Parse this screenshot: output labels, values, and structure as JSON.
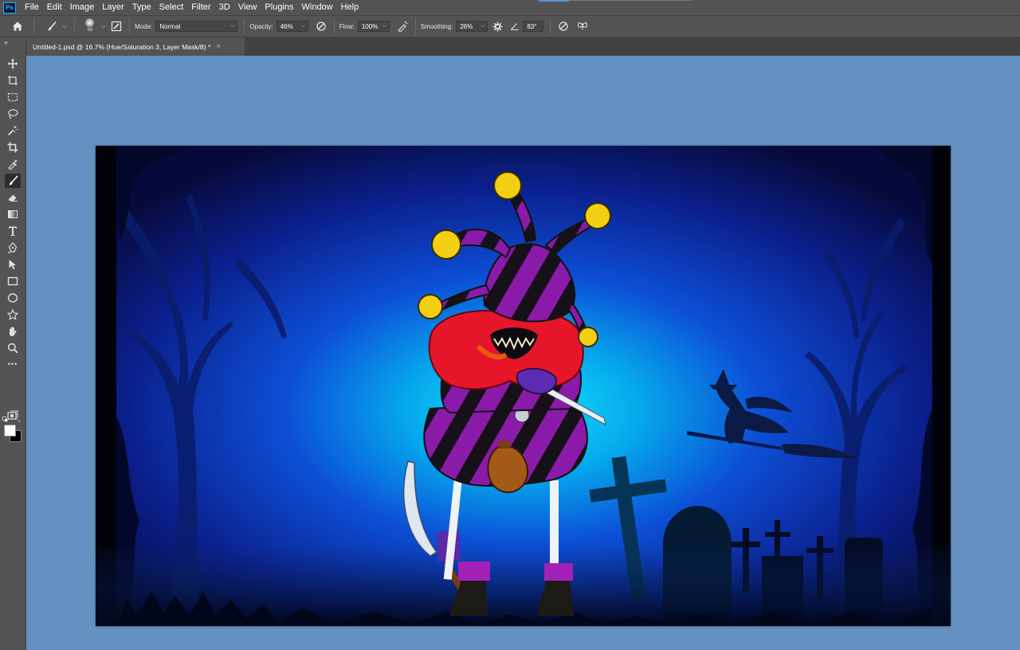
{
  "app": {
    "logo_text": "Ps"
  },
  "menu": [
    "File",
    "Edit",
    "Image",
    "Layer",
    "Type",
    "Select",
    "Filter",
    "3D",
    "View",
    "Plugins",
    "Window",
    "Help"
  ],
  "options": {
    "brush_size": "88",
    "mode_label": "Mode:",
    "mode_value": "Normal",
    "opacity_label": "Opacity:",
    "opacity_value": "46%",
    "flow_label": "Flow:",
    "flow_value": "100%",
    "smoothing_label": "Smoothing:",
    "smoothing_value": "26%",
    "angle_value": "83°"
  },
  "document": {
    "tab_title": "Untitled-1.psd @ 16.7% (Hue/Saturation 3, Layer Mask/8) *",
    "close_glyph": "×"
  },
  "toolbar": {
    "collapse_glyph": "»",
    "tools": [
      "move",
      "artboard",
      "rectangular-marquee",
      "lasso",
      "magic-wand",
      "crop",
      "eyedropper",
      "brush",
      "eraser",
      "gradient",
      "type",
      "pen",
      "path-selection",
      "rectangle",
      "ellipse",
      "custom-shape",
      "hand",
      "zoom",
      "more"
    ],
    "active_tool": "brush",
    "more_glyph": "•••"
  },
  "colors": {
    "foreground": "#ffffff",
    "background": "#000000",
    "workspace": "#6591c2",
    "ui_panel": "#535353"
  }
}
